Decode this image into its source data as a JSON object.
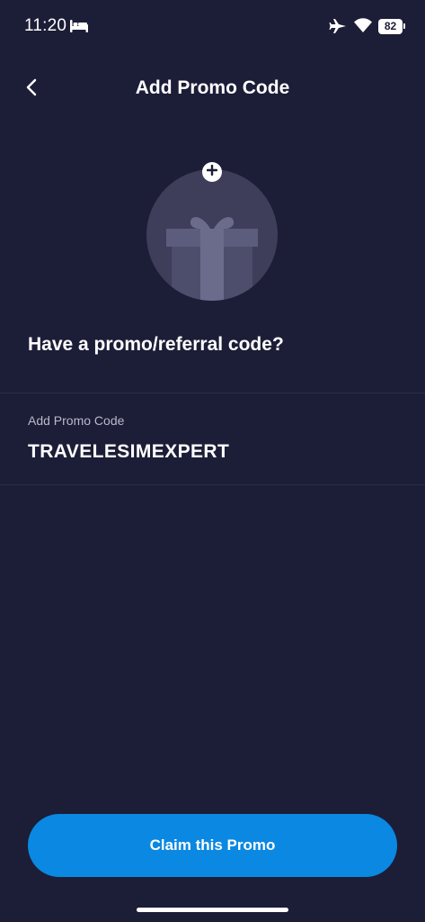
{
  "status_bar": {
    "time": "11:20",
    "battery_level": "82",
    "icons": [
      "bed-icon",
      "airplane-icon",
      "wifi-icon",
      "battery-icon"
    ]
  },
  "header": {
    "back_icon": "chevron-left-icon",
    "title": "Add Promo Code"
  },
  "illustration": {
    "icon": "gift-icon",
    "badge_icon": "plus-icon"
  },
  "main": {
    "heading": "Have a promo/referral code?",
    "promo_field": {
      "label": "Add Promo Code",
      "value": "TRAVELESIMEXPERT"
    }
  },
  "footer": {
    "claim_label": "Claim this Promo"
  },
  "colors": {
    "background": "#1c1d36",
    "accent": "#0a88e2",
    "circle": "#3e3e5b",
    "divider": "#2b2c48",
    "muted_text": "#b9bacb"
  }
}
